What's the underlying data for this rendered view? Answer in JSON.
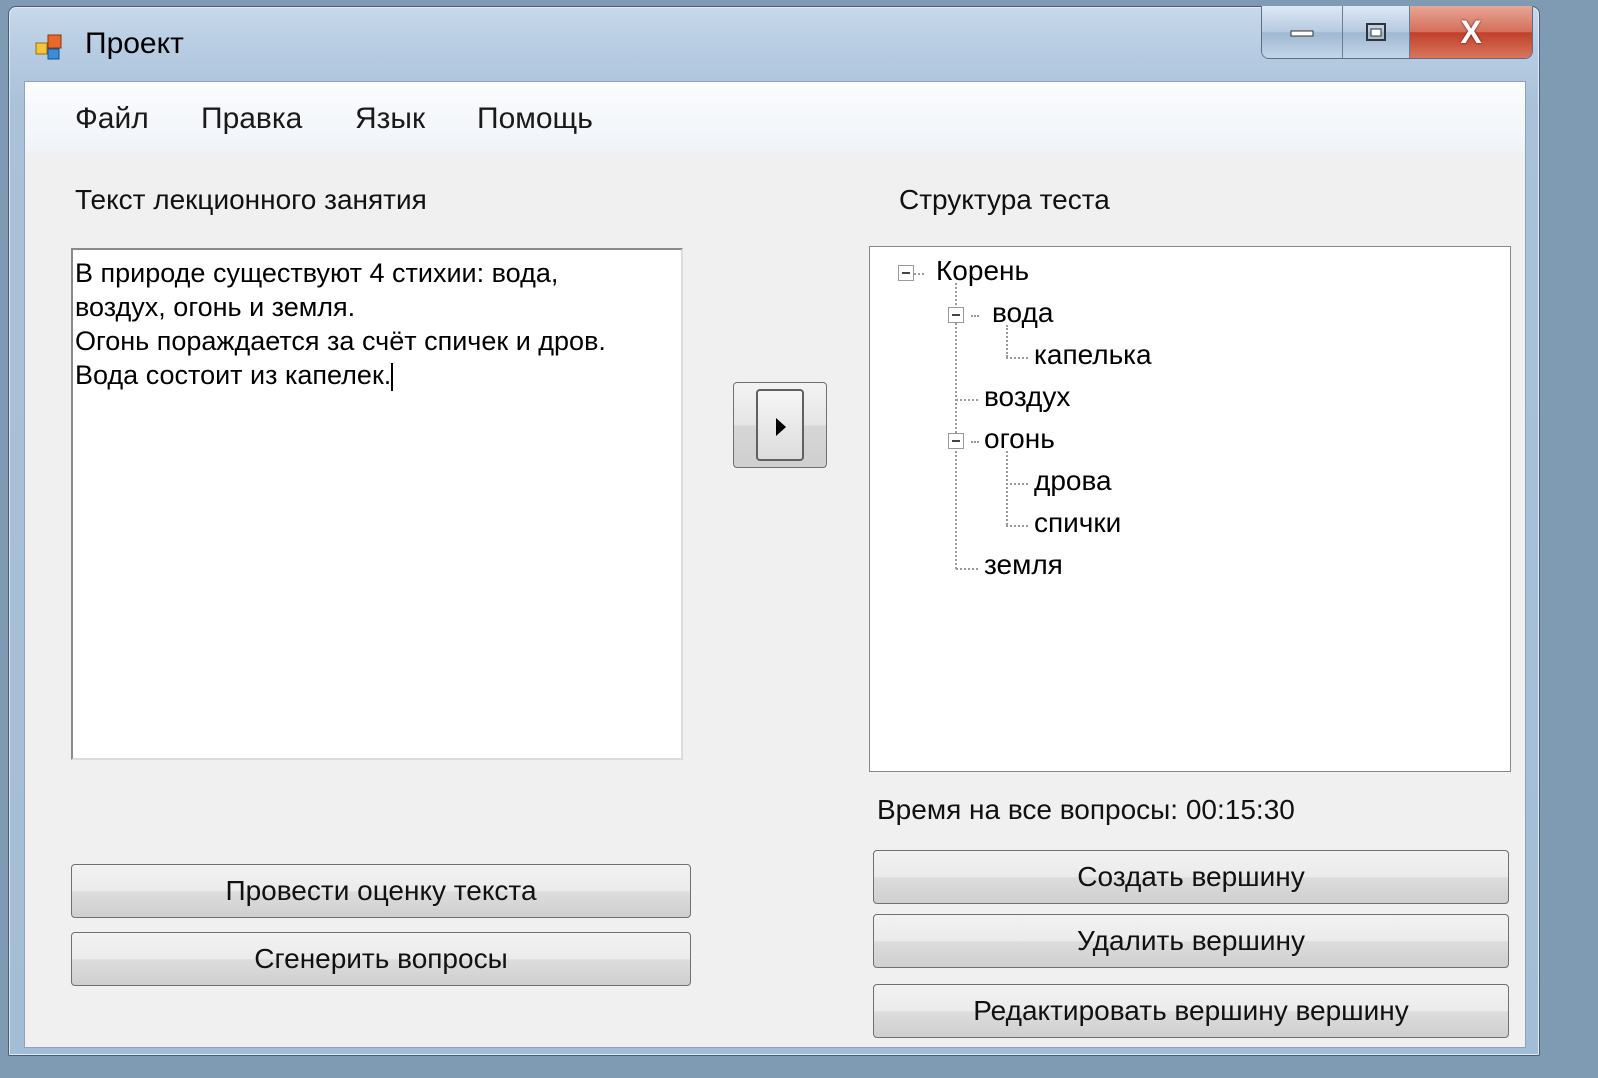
{
  "window": {
    "title": "Проект",
    "close_glyph": "X"
  },
  "menu": {
    "items": [
      "Файл",
      "Правка",
      "Язык",
      "Помощь"
    ]
  },
  "left": {
    "label": "Текст лекционного занятия",
    "text_lines": [
      "В природе существуют 4 стихии: вода,",
      "воздух, огонь и земля.",
      "Огонь пораждается за счёт спичек и дров.",
      "Вода состоит из капелек."
    ],
    "evaluate_button": "Провести оценку текста",
    "generate_button": "Сгенерить вопросы"
  },
  "right": {
    "label": "Структура теста",
    "tree": {
      "root": "Корень",
      "voda": "вода",
      "kapelka": "капелька",
      "vozduh": "воздух",
      "ogon": "огонь",
      "drova": "дрова",
      "spichki": "спички",
      "zemlya": "земля"
    },
    "time_label": "Время на все вопросы: 00:15:30",
    "create_button": "Создать вершину",
    "delete_button": "Удалить вершину",
    "edit_button": "Редактировать вершину вершину"
  },
  "icons": {
    "app": "app-window-icon",
    "transfer": "play-arrow-icon"
  }
}
